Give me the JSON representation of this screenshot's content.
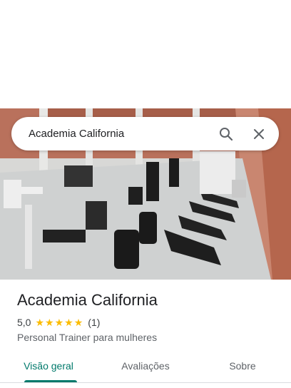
{
  "search": {
    "query": "Academia California"
  },
  "place": {
    "name": "Academia California",
    "rating": "5,0",
    "rating_value": 5,
    "review_count": "(1)",
    "category": "Personal Trainer para mulheres"
  },
  "tabs": [
    {
      "label": "Visão geral",
      "active": true
    },
    {
      "label": "Avaliações",
      "active": false
    },
    {
      "label": "Sobre",
      "active": false
    }
  ],
  "colors": {
    "accent": "#00796b",
    "star": "#fbbc04"
  }
}
